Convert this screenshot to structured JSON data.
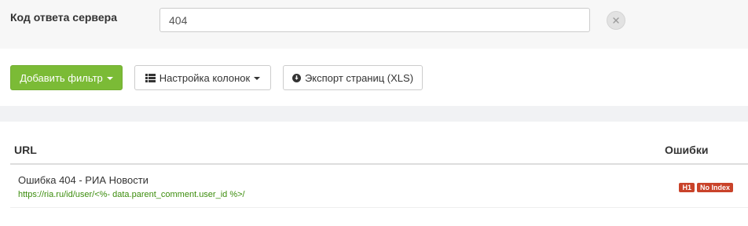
{
  "filter": {
    "label": "Код ответа сервера",
    "value": "404"
  },
  "toolbar": {
    "add_filter_label": "Добавить фильтр",
    "columns_label": "Настройка колонок",
    "export_label": "Экспорт страниц (XLS)"
  },
  "table": {
    "columns": [
      "URL",
      "Ошибки"
    ],
    "rows": [
      {
        "title": "Ошибка 404 - РИА Новости",
        "url": "https://ria.ru/id/user/<%- data.parent_comment.user_id %>/",
        "badges": [
          "H1",
          "No Index"
        ]
      }
    ]
  },
  "colors": {
    "primary_button": "#7bbb36",
    "badge": "#c9432a",
    "link": "#3c8d0d"
  },
  "icons": {
    "remove_filter": "close-icon",
    "columns": "list-icon",
    "export": "download-circle-icon"
  }
}
